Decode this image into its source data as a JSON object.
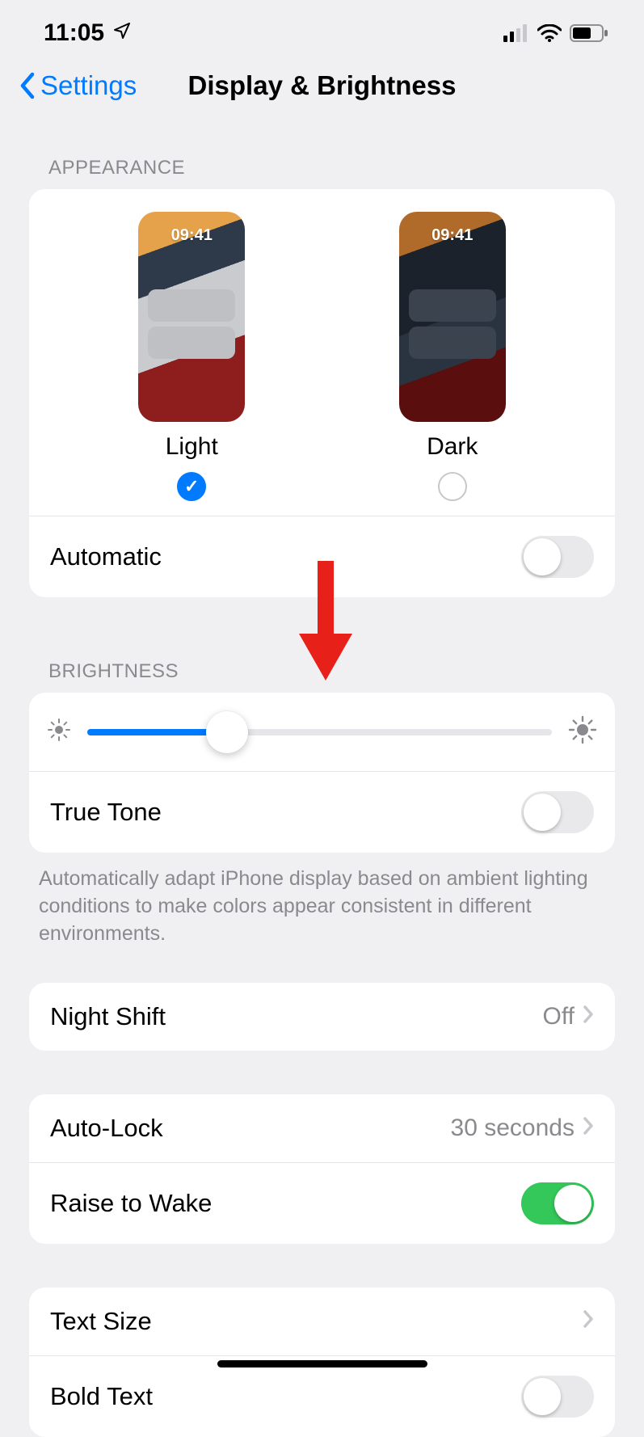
{
  "status": {
    "time": "11:05"
  },
  "nav": {
    "back_label": "Settings",
    "title": "Display & Brightness"
  },
  "appearance": {
    "header": "APPEARANCE",
    "options": [
      {
        "label": "Light",
        "selected": true,
        "mock_time": "09:41"
      },
      {
        "label": "Dark",
        "selected": false,
        "mock_time": "09:41"
      }
    ],
    "automatic": {
      "label": "Automatic",
      "on": false
    }
  },
  "brightness": {
    "header": "BRIGHTNESS",
    "slider_percent": 30,
    "true_tone": {
      "label": "True Tone",
      "on": false
    },
    "footer": "Automatically adapt iPhone display based on ambient lighting conditions to make colors appear consistent in different environments."
  },
  "night_shift": {
    "label": "Night Shift",
    "value": "Off"
  },
  "auto_lock": {
    "label": "Auto-Lock",
    "value": "30 seconds"
  },
  "raise_to_wake": {
    "label": "Raise to Wake",
    "on": true
  },
  "text_size": {
    "label": "Text Size"
  },
  "bold_text": {
    "label": "Bold Text",
    "on": false
  },
  "annotation": {
    "arrow_color": "#e8201a"
  }
}
